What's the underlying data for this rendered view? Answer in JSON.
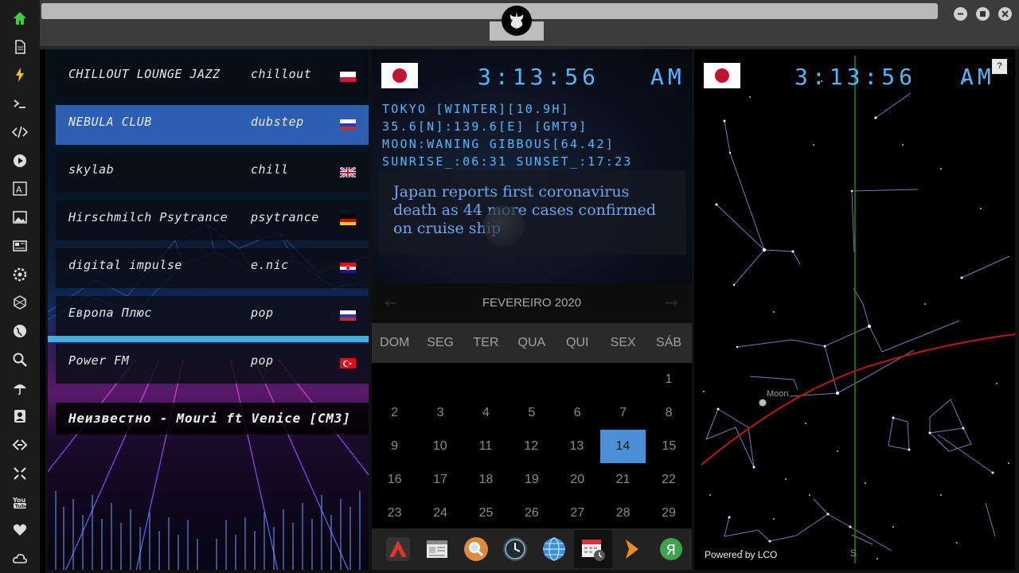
{
  "sidebar": {
    "icons": [
      "home-icon",
      "document-icon",
      "bolt-icon",
      "terminal-icon",
      "code-icon",
      "play-icon",
      "translate-icon",
      "image-icon",
      "news-icon",
      "settings-gear-icon",
      "network-icon",
      "globe-icon",
      "search-icon",
      "umbrella-icon",
      "contact-icon",
      "link-icon",
      "expand-icon",
      "youtube-icon",
      "heart-icon",
      "cloud-icon"
    ]
  },
  "radio": {
    "stations": [
      {
        "name": "CHILLOUT LOUNGE JAZZ",
        "genre": "chillout",
        "flag": "poland"
      },
      {
        "name": "NEBULA CLUB",
        "genre": "dubstep",
        "flag": "russia"
      },
      {
        "name": "skylab",
        "genre": "chill",
        "flag": "uk"
      },
      {
        "name": "Hirschmilch Psytrance",
        "genre": "psytrance",
        "flag": "germany"
      },
      {
        "name": "digital impulse",
        "genre": "e.nic",
        "flag": "croatia"
      },
      {
        "name": "Европа Плюс",
        "genre": "pop",
        "flag": "russia"
      },
      {
        "name": "Power FM",
        "genre": "pop",
        "flag": "turkey"
      }
    ],
    "active_index": 1,
    "now_playing": "Неизвестно - Mouri ft Venice [CM3]"
  },
  "clock": {
    "time": "3:13:56",
    "ampm": "AM",
    "location": "TOKYO [WINTER][10.9H]",
    "coords": "35.6[N]:139.6[E] [GMT9]",
    "moon": "MOON:WANING GIBBOUS[64.42]",
    "sun": "SUNRISE_:06:31 SUNSET_:17:23",
    "news": "Japan reports first coronavirus death as 44 more cases confirmed on cruise ship"
  },
  "calendar": {
    "month": "FEVEREIRO 2020",
    "prev": "←",
    "next": "→",
    "weekdays": [
      "DOM",
      "SEG",
      "TER",
      "QUA",
      "QUI",
      "SEX",
      "SÁB"
    ],
    "weeks": [
      [
        "",
        "",
        "",
        "",
        "",
        "",
        "1"
      ],
      [
        "2",
        "3",
        "4",
        "5",
        "6",
        "7",
        "8"
      ],
      [
        "9",
        "10",
        "11",
        "12",
        "13",
        "14",
        "15"
      ],
      [
        "16",
        "17",
        "18",
        "19",
        "20",
        "21",
        "22"
      ],
      [
        "23",
        "24",
        "25",
        "26",
        "27",
        "28",
        "29"
      ]
    ],
    "today": "14"
  },
  "dock": {
    "items": [
      "arch-icon",
      "calendar-text-icon",
      "search-app-icon",
      "clock-app-icon",
      "browser-globe-icon",
      "calendar-clock-icon",
      "arrow-app-icon",
      "yandex-icon"
    ]
  },
  "sky": {
    "time": "3:13:56",
    "ampm": "AM",
    "help": "?",
    "moon_label": "Moon",
    "south_label": "S",
    "powered": "Powered by LCO"
  },
  "colors": {
    "clock_blue": "#4fb8ff",
    "today_blue": "#4a8fd8",
    "active_station": "#2d5fb0",
    "ecliptic": "#b01818",
    "meridian": "#1e8a1e"
  }
}
